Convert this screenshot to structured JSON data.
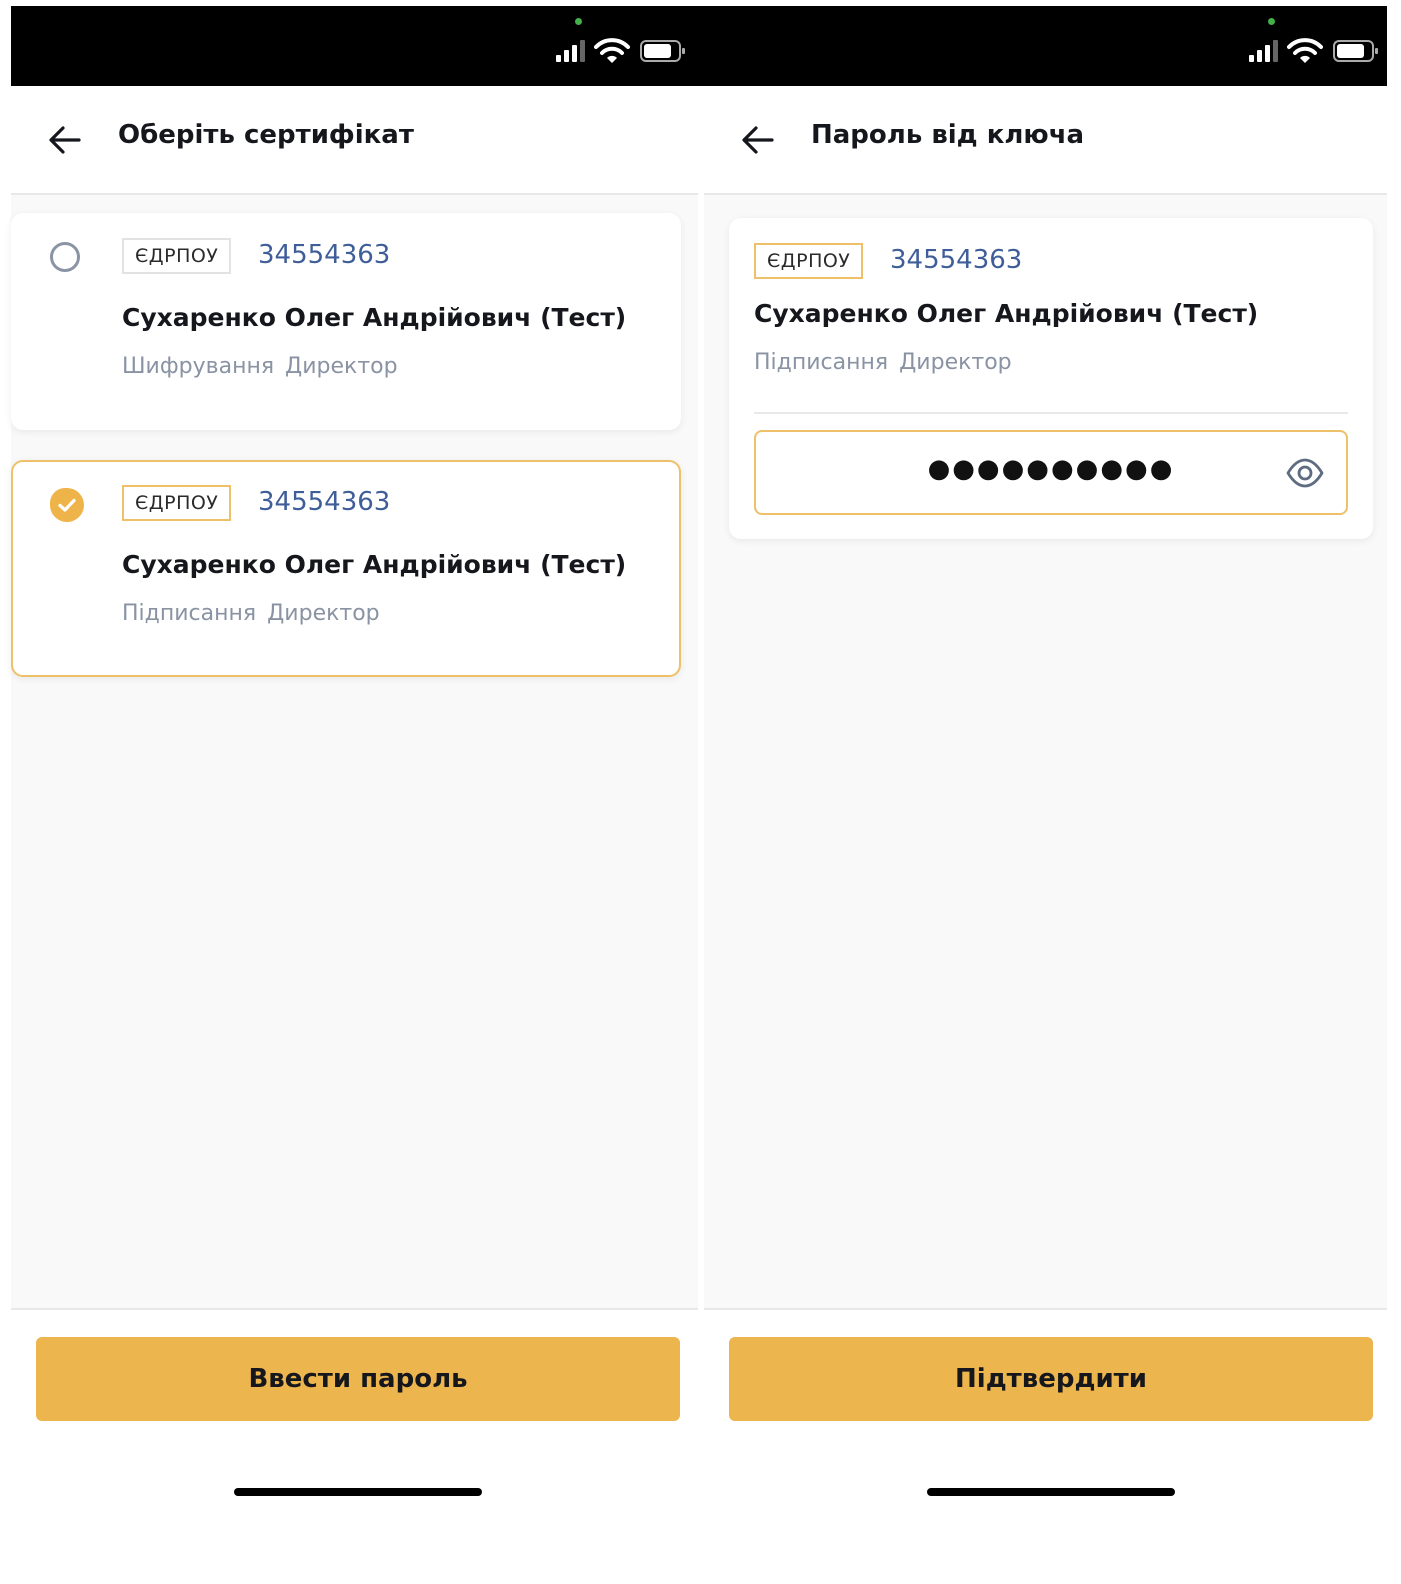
{
  "status_bar": {
    "icons": [
      "camera-in-use-dot-icon",
      "cellular-signal-icon",
      "wifi-icon",
      "battery-icon"
    ],
    "colors": {
      "background": "#000000",
      "indicator": "#43b04a"
    }
  },
  "left_screen": {
    "header": {
      "title": "Оберіть сертифікат",
      "back_icon": "arrow-left-icon"
    },
    "certificates": [
      {
        "selected": false,
        "badge": "ЄДРПОУ",
        "code": "34554363",
        "name": "Сухаренко Олег Андрійович (Тест)",
        "subtitle": "Шифрування Директор"
      },
      {
        "selected": true,
        "badge": "ЄДРПОУ",
        "code": "34554363",
        "name": "Сухаренко Олег Андрійович (Тест)",
        "subtitle": "Підписання Директор"
      }
    ],
    "button_label": "Ввести пароль"
  },
  "right_screen": {
    "header": {
      "title": "Пароль від ключа",
      "back_icon": "arrow-left-icon"
    },
    "certificate": {
      "badge": "ЄДРПОУ",
      "code": "34554363",
      "name": "Сухаренко Олег Андрійович (Тест)",
      "subtitle": "Підписання Директор"
    },
    "password": {
      "masked_value": "●●●●●●●●●●",
      "toggle_icon": "eye-icon"
    },
    "button_label": "Підтвердити"
  },
  "colors": {
    "accent": "#edb54e",
    "accent_border": "#efc06a",
    "code_blue": "#3f5e99",
    "muted_text": "#8a93a3",
    "screen_background": "#f9f9f9"
  }
}
